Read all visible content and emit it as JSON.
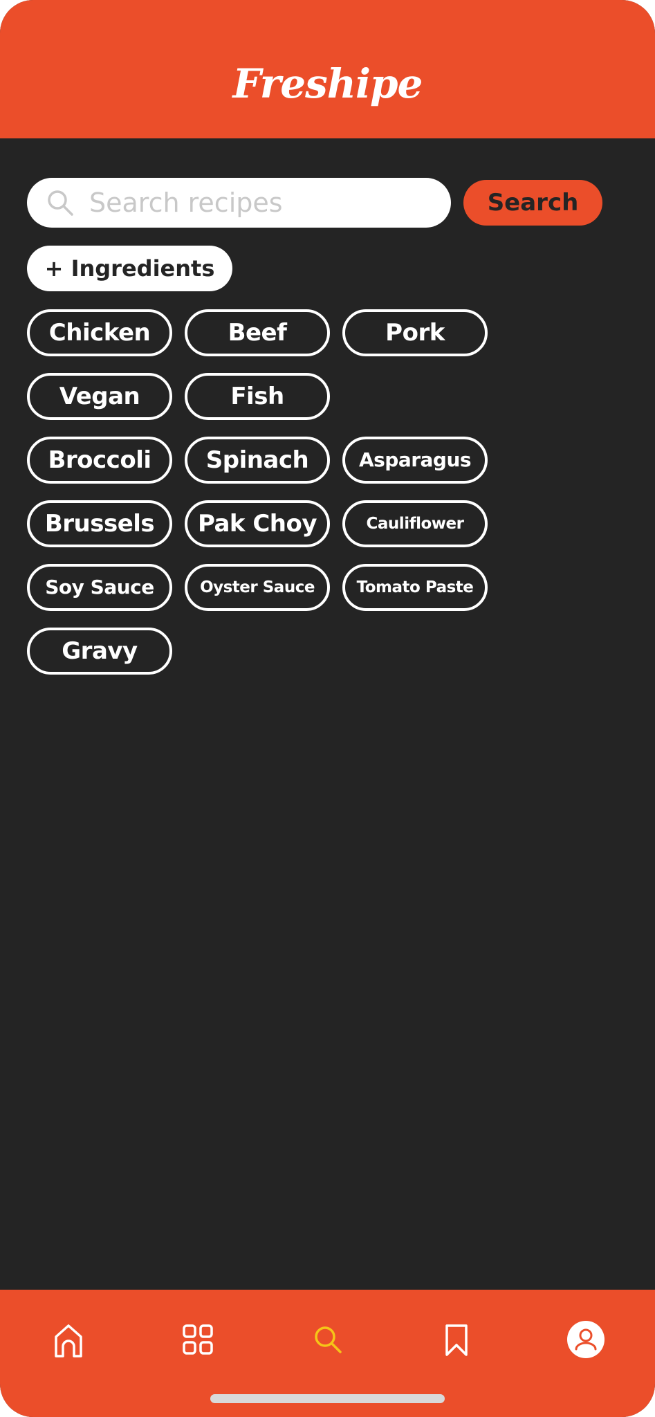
{
  "app": {
    "title": "Freshipe"
  },
  "search": {
    "placeholder": "Search recipes",
    "value": "",
    "button_label": "Search"
  },
  "ingredients_button": {
    "label": "+ Ingredients"
  },
  "chips": [
    "Chicken",
    "Beef",
    "Pork",
    "Vegan",
    "Fish",
    "Broccoli",
    "Spinach",
    "Asparagus",
    "Brussels",
    "Pak Choy",
    "Cauliflower",
    "Soy Sauce",
    "Oyster Sauce",
    "Tomato Paste",
    "Gravy"
  ],
  "nav": {
    "items": [
      {
        "icon": "home-icon",
        "active": false
      },
      {
        "icon": "grid-icon",
        "active": false
      },
      {
        "icon": "search-icon",
        "active": true
      },
      {
        "icon": "bookmark-icon",
        "active": false
      },
      {
        "icon": "profile-icon",
        "active": false
      }
    ]
  },
  "colors": {
    "brand": "#EB4E2A",
    "background": "#242424",
    "active_icon": "#F5C518",
    "icon": "#ffffff"
  }
}
